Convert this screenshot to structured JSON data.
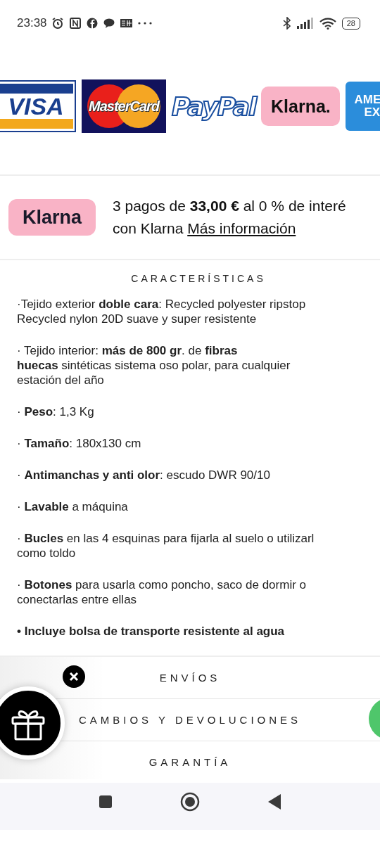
{
  "status_bar": {
    "time": "23:38",
    "battery": "28"
  },
  "payment_logos": [
    {
      "kind": "visa",
      "text": "VISA"
    },
    {
      "kind": "mastercard",
      "text": "MasterCard"
    },
    {
      "kind": "paypal",
      "text": "PayPal"
    },
    {
      "kind": "klarna",
      "text": "Klarna."
    },
    {
      "kind": "amex",
      "text": "AME",
      "text2": "EX"
    }
  ],
  "klarna_offer": {
    "badge": "Klarna",
    "line1": "3 pagos de **33,00 €** al 0 % de interé",
    "line2": "con Klarna",
    "link": "Más información"
  },
  "features": {
    "title": "CARACTERÍSTICAS",
    "items": [
      {
        "emphasis": false,
        "lines": [
          "·Tejido exterior **doble cara**: Recycled polyester ripstop",
          "Recycled nylon 20D suave y super resistente"
        ]
      },
      {
        "emphasis": false,
        "lines": [
          "· Tejido interior: **más de 800 gr**. de **fibras**",
          "**huecas** sintéticas sistema oso polar, para cualquier",
          "estación del año"
        ]
      },
      {
        "emphasis": false,
        "lines": [
          "· **Peso**: 1,3 Kg"
        ]
      },
      {
        "emphasis": false,
        "lines": [
          "· **Tamaño**: 180x130 cm"
        ]
      },
      {
        "emphasis": false,
        "lines": [
          "· **Antimanchas y anti olor**: escudo DWR 90/10"
        ]
      },
      {
        "emphasis": false,
        "lines": [
          "· **Lavable** a máquina"
        ]
      },
      {
        "emphasis": false,
        "lines": [
          "· **Bucles** en las 4 esquinas para fijarla al suelo o utilizarl",
          "como toldo"
        ]
      },
      {
        "emphasis": false,
        "lines": [
          "· **Botones** para usarla como poncho, saco de dormir o",
          "conectarlas entre ellas"
        ]
      },
      {
        "emphasis": true,
        "lines": [
          "• Incluye bolsa de transporte resistente al agua"
        ]
      }
    ]
  },
  "accordion": [
    {
      "label": "ENVÍOS"
    },
    {
      "label": "CAMBIOS Y DEVOLUCIONES"
    },
    {
      "label": "GARANTÍA"
    }
  ]
}
